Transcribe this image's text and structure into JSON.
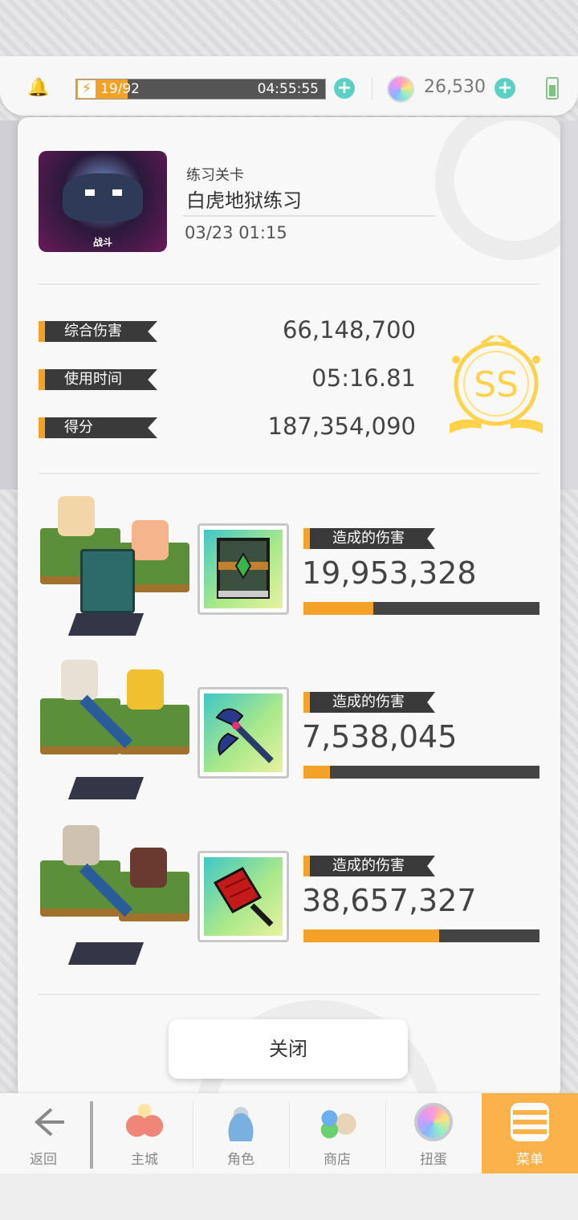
{
  "status_bar": {
    "energy_text": "19/92",
    "energy_fraction": 0.2065,
    "energy_timer": "04:55:55",
    "gem_count": "26,530"
  },
  "stage": {
    "thumb_label": "战斗",
    "type": "练习关卡",
    "name": "白虎地狱练习",
    "time": "03/23 01:15"
  },
  "stats": [
    {
      "label": "综合伤害",
      "value": "66,148,700"
    },
    {
      "label": "使用时间",
      "value": "05:16.81"
    },
    {
      "label": "得分",
      "value": "187,354,090"
    }
  ],
  "rank": "SS",
  "teams": [
    {
      "damage_label": "造成的伤害",
      "damage": "19,953,328",
      "fraction": 0.297,
      "equip_icon": "green-book-icon"
    },
    {
      "damage_label": "造成的伤害",
      "damage": "7,538,045",
      "fraction": 0.112,
      "equip_icon": "battle-axe-icon"
    },
    {
      "damage_label": "造成的伤害",
      "damage": "38,657,327",
      "fraction": 0.576,
      "equip_icon": "red-flag-icon"
    }
  ],
  "close_label": "关闭",
  "nav": [
    {
      "label": "返回",
      "icon": "back-arrow-icon"
    },
    {
      "label": "主城",
      "icon": "main-city-icon"
    },
    {
      "label": "角色",
      "icon": "character-icon"
    },
    {
      "label": "商店",
      "icon": "shop-icon"
    },
    {
      "label": "扭蛋",
      "icon": "gacha-icon"
    },
    {
      "label": "菜单",
      "icon": "menu-icon"
    }
  ],
  "colors": {
    "accent": "#f4a227",
    "rank_gold": "#ffd24a",
    "label_dark": "#3a3a3a"
  }
}
